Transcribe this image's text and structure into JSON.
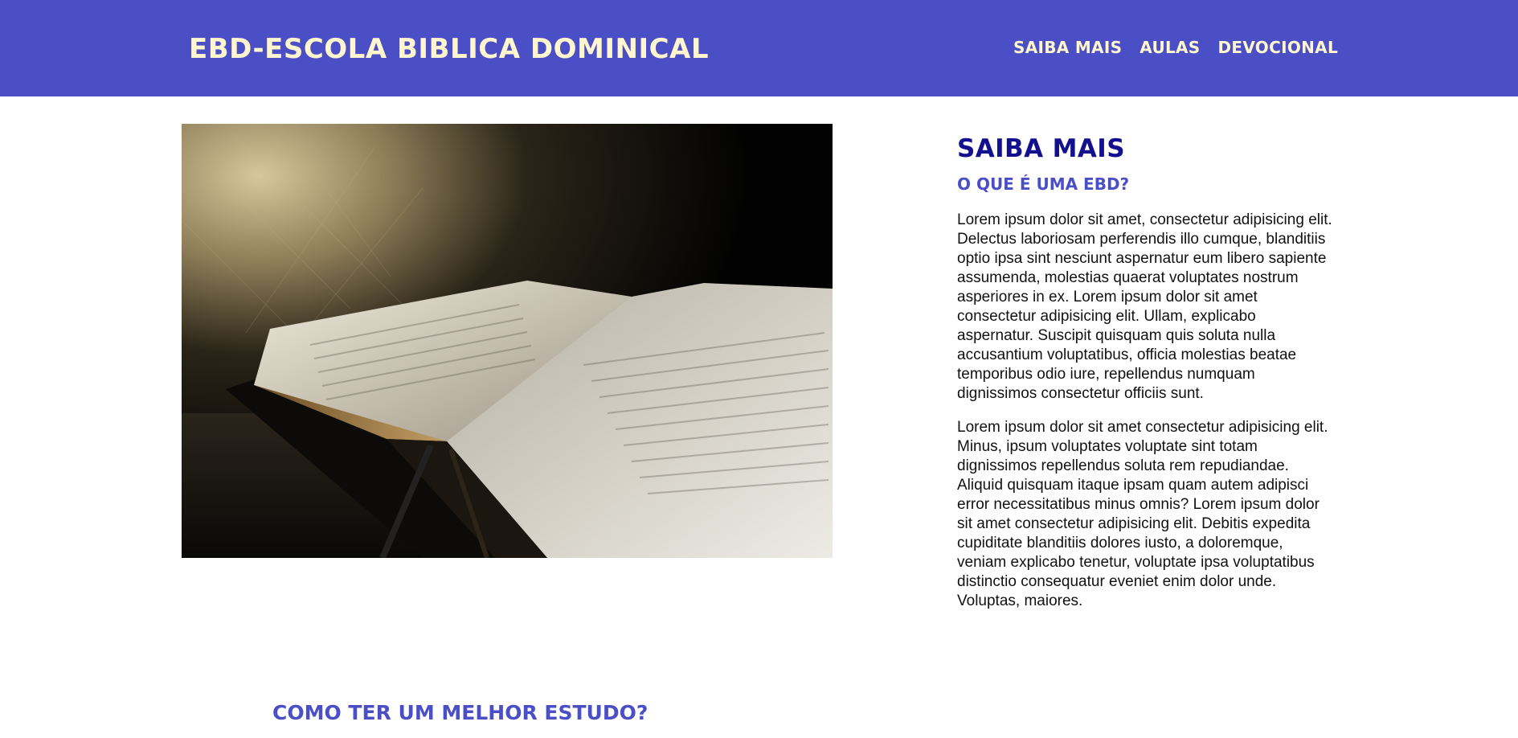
{
  "header": {
    "title": "EBD-ESCOLA BIBLICA DOMINICAL",
    "nav": [
      "SAIBA MAIS",
      "AULAS",
      "DEVOCIONAL"
    ]
  },
  "hero": {
    "image": "open-bible-photo"
  },
  "about": {
    "heading": "SAIBA MAIS",
    "subheading": "O QUE É UMA EBD?",
    "paragraphs": [
      "Lorem ipsum dolor sit amet, consectetur adipisicing elit. Delectus laboriosam perferendis illo cumque, blanditiis optio ipsa sint nesciunt aspernatur eum libero sapiente assumenda, molestias quaerat voluptates nostrum asperiores in ex. Lorem ipsum dolor sit amet consectetur adipisicing elit. Ullam, explicabo aspernatur. Suscipit quisquam quis soluta nulla accusantium voluptatibus, officia molestias beatae temporibus odio iure, repellendus numquam dignissimos consectetur officiis sunt.",
      "Lorem ipsum dolor sit amet consectetur adipisicing elit. Minus, ipsum voluptates voluptate sint totam dignissimos repellendus soluta rem repudiandae. Aliquid quisquam itaque ipsam quam autem adipisci error necessitatibus minus omnis? Lorem ipsum dolor sit amet consectetur adipisicing elit. Debitis expedita cupiditate blanditiis dolores iusto, a doloremque, veniam explicabo tenetur, voluptate ipsa voluptatibus distinctio consequatur eveniet enim dolor unde. Voluptas, maiores."
    ]
  },
  "study": {
    "heading": "COMO TER UM MELHOR ESTUDO?"
  },
  "colors": {
    "header_bg": "#4b4fc6",
    "header_text": "#fff6cf",
    "heading_dark": "#12108f",
    "heading_accent": "#4b4fc6"
  }
}
